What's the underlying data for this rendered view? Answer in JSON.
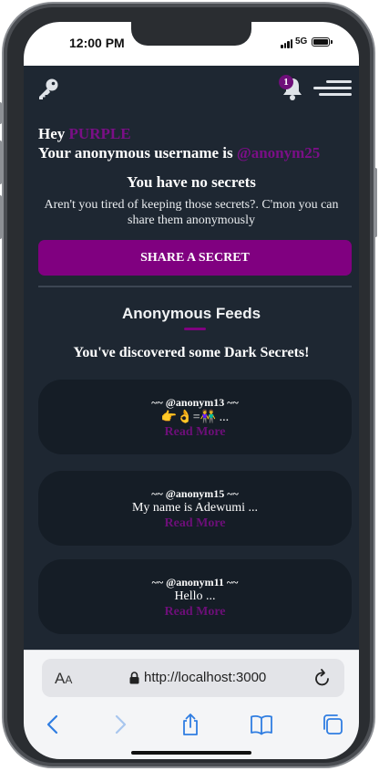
{
  "status_bar": {
    "time": "12:00 PM",
    "network": "5G"
  },
  "header": {
    "notification_count": "1"
  },
  "greeting": {
    "hey": "Hey",
    "name": "PURPLE",
    "username_prefix": "Your anonymous username is",
    "username": "@anonym25"
  },
  "empty_state": {
    "title": "You have no secrets",
    "text": "Aren't you tired of keeping those secrets?. C'mon you can share them anonymously"
  },
  "share_button": "SHARE A SECRET",
  "feeds": {
    "title": "Anonymous Feeds",
    "subtitle": "You've discovered some Dark Secrets!",
    "items": [
      {
        "author": "~~ @anonym13 ~~",
        "text": "👉👌=👫 ...",
        "read_more": "Read More"
      },
      {
        "author": "~~ @anonym15 ~~",
        "text": "My name is Adewumi ...",
        "read_more": "Read More"
      },
      {
        "author": "~~ @anonym11 ~~",
        "text": "Hello ...",
        "read_more": "Read More"
      }
    ]
  },
  "browser": {
    "text_size_label": "A",
    "text_size_label_small": "A",
    "url": "http://localhost:3000"
  },
  "colors": {
    "brand": "#800080",
    "background": "#1e2732",
    "card": "#151d26"
  }
}
